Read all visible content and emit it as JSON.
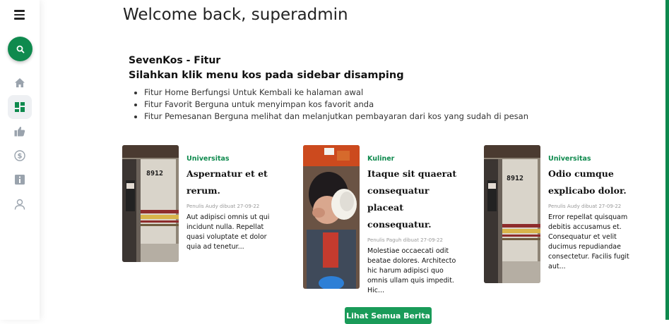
{
  "sidebar": {
    "icons": [
      "menu-icon",
      "search-icon",
      "home-icon",
      "dashboard-icon",
      "thumbs-up-icon",
      "dollar-icon",
      "info-icon",
      "user-icon"
    ],
    "accent_color": "#0f8a4e"
  },
  "page_title": "Welcome back, superadmin",
  "fitur": {
    "title": "SevenKos - Fitur",
    "subtitle": "Silahkan klik menu kos pada sidebar disamping",
    "items": [
      "Fitur Home Berfungsi Untuk Kembali ke halaman awal",
      "Fitur Favorit Berguna untuk menyimpan kos favorit anda",
      "Fitur Pemesanan Berguna melihat dan melanjutkan pembayaran dari kos yang sudah di pesan"
    ]
  },
  "news": [
    {
      "category": "Universitas",
      "title": "Aspernatur et et rerum.",
      "meta": "Penulis Audy dibuat 27-09-22",
      "excerpt": "Aut adipisci omnis ut qui incidunt nulla. Repellat quasi voluptate et dolor quia ad tenetur...",
      "image": "train-door-photo"
    },
    {
      "category": "Kuliner",
      "title": "Itaque sit quaerat consequatur placeat consequatur.",
      "meta": "Penulis Paguh dibuat 27-09-22",
      "excerpt": "Molestiae occaecati odit beatae dolores. Architecto hic harum adipisci quo omnis ullam quis impedit. Hic...",
      "image": "child-drinking-photo"
    },
    {
      "category": "Universitas",
      "title": "Odio cumque explicabo dolor.",
      "meta": "Penulis Audy dibuat 27-09-22",
      "excerpt": "Error repellat quisquam debitis accusamus et. Consequatur et velit ducimus repudiandae consectetur. Facilis fugit aut...",
      "image": "train-door-photo"
    }
  ],
  "train_number": "8912",
  "see_all_label": "Lihat Semua Berita"
}
